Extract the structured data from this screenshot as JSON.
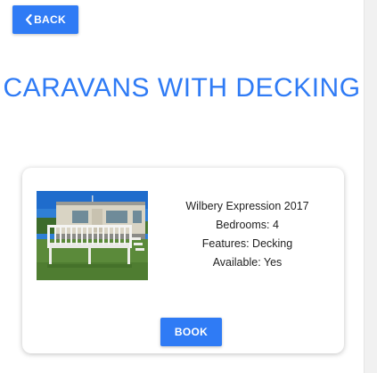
{
  "header": {
    "back_label": "BACK",
    "title": "CARAVANS WITH DECKING"
  },
  "listing": {
    "name": "Wilbery Expression 2017",
    "bedrooms": "Bedrooms: 4",
    "features": "Features: Decking",
    "available": "Available: Yes",
    "book_label": "BOOK",
    "photo_alt": "Caravan with white decking"
  },
  "colors": {
    "accent": "#2f7bf5",
    "text": "#222222",
    "card_bg": "#ffffff"
  },
  "icons": {
    "back": "chevron-left-icon"
  }
}
